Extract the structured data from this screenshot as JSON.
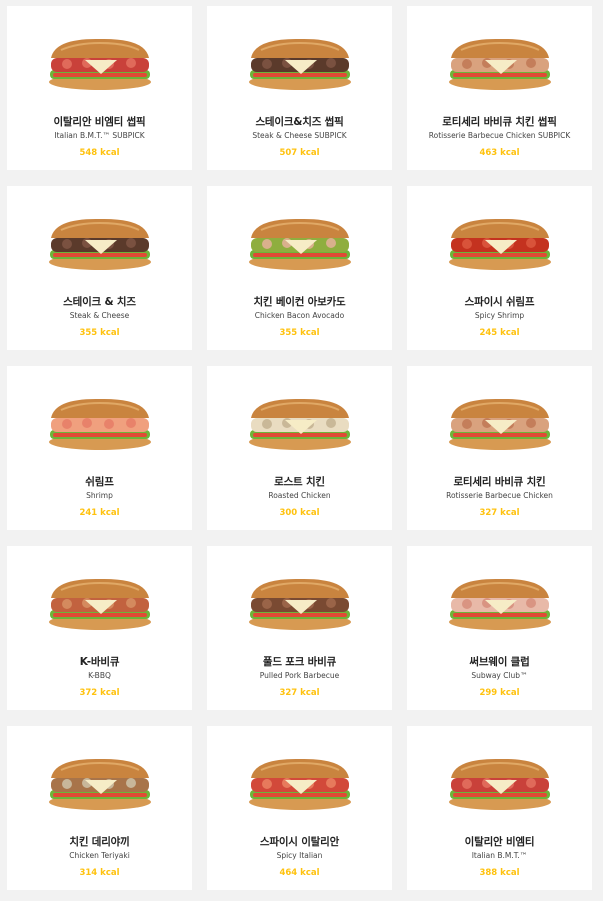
{
  "colors": {
    "kcal": "#ffc20e",
    "background": "#f2f2f2",
    "card": "#ffffff"
  },
  "menu": [
    {
      "name_ko": "이탈리안 비엠티 썹픽",
      "name_en": "Italian B.M.T.™ SUBPICK",
      "kcal": "548 kcal",
      "filling": "salami"
    },
    {
      "name_ko": "스테이크&치즈 썹픽",
      "name_en": "Steak & Cheese SUBPICK",
      "kcal": "507 kcal",
      "filling": "steak"
    },
    {
      "name_ko": "로티세리 바비큐 치킨 썹픽",
      "name_en": "Rotisserie Barbecue Chicken SUBPICK",
      "kcal": "463 kcal",
      "filling": "pulled"
    },
    {
      "name_ko": "스테이크 & 치즈",
      "name_en": "Steak & Cheese",
      "kcal": "355 kcal",
      "filling": "steak"
    },
    {
      "name_ko": "치킨 베이컨 아보카도",
      "name_en": "Chicken Bacon Avocado",
      "kcal": "355 kcal",
      "filling": "avocado"
    },
    {
      "name_ko": "스파이시 쉬림프",
      "name_en": "Spicy Shrimp",
      "kcal": "245 kcal",
      "filling": "spicy"
    },
    {
      "name_ko": "쉬림프",
      "name_en": "Shrimp",
      "kcal": "241 kcal",
      "filling": "shrimp"
    },
    {
      "name_ko": "로스트 치킨",
      "name_en": "Roasted Chicken",
      "kcal": "300 kcal",
      "filling": "chicken"
    },
    {
      "name_ko": "로티세리 바비큐 치킨",
      "name_en": "Rotisserie Barbecue Chicken",
      "kcal": "327 kcal",
      "filling": "pulled"
    },
    {
      "name_ko": "K-바비큐",
      "name_en": "K-BBQ",
      "kcal": "372 kcal",
      "filling": "bbq"
    },
    {
      "name_ko": "풀드 포크 바비큐",
      "name_en": "Pulled Pork Barbecue",
      "kcal": "327 kcal",
      "filling": "pork"
    },
    {
      "name_ko": "써브웨이 클럽",
      "name_en": "Subway Club™",
      "kcal": "299 kcal",
      "filling": "ham"
    },
    {
      "name_ko": "치킨 데리야끼",
      "name_en": "Chicken Teriyaki",
      "kcal": "314 kcal",
      "filling": "teriyaki"
    },
    {
      "name_ko": "스파이시 이탈리안",
      "name_en": "Spicy Italian",
      "kcal": "464 kcal",
      "filling": "pepperoni"
    },
    {
      "name_ko": "이탈리안 비엠티",
      "name_en": "Italian B.M.T.™",
      "kcal": "388 kcal",
      "filling": "salami"
    }
  ]
}
